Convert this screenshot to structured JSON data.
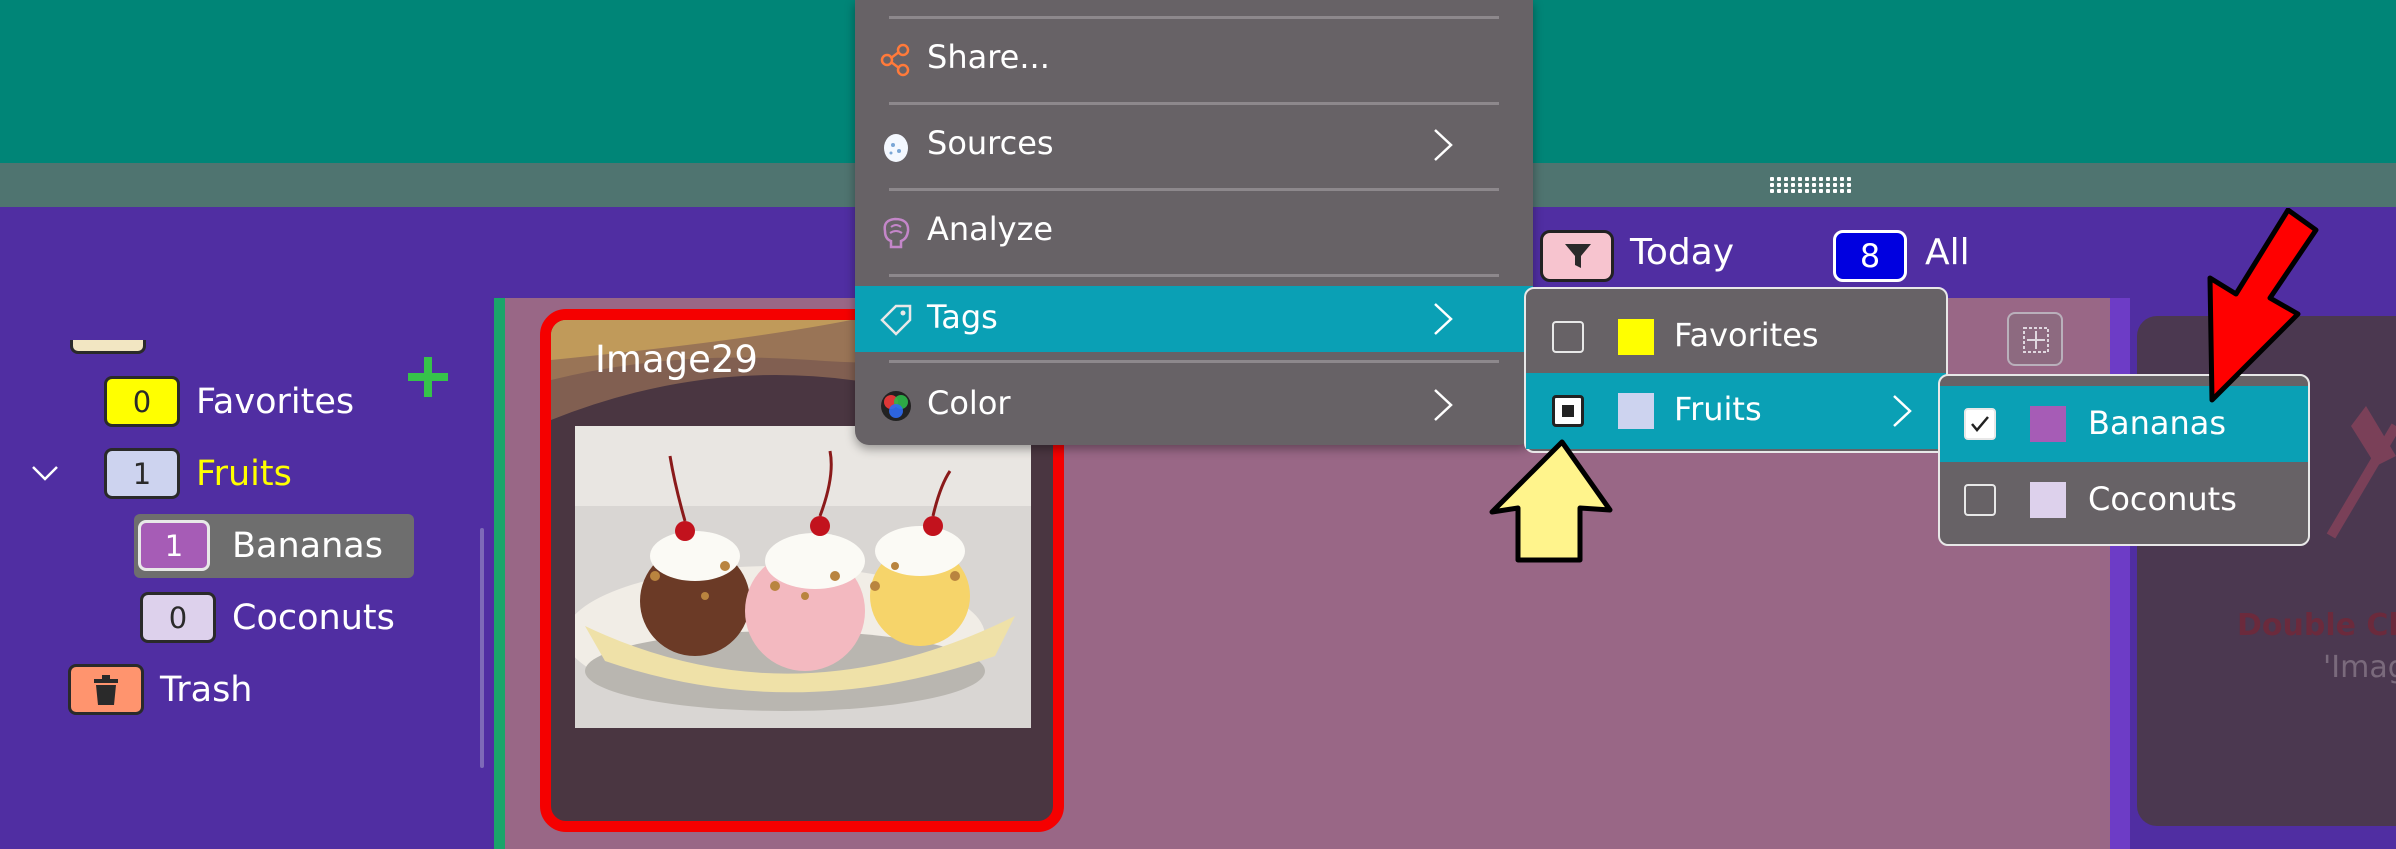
{
  "sidebar": {
    "tags": [
      {
        "name": "Favorites",
        "count": "0",
        "color": "#ffff00"
      },
      {
        "name": "Fruits",
        "count": "1",
        "color": "#cdd3ef"
      },
      {
        "name": "Bananas",
        "count": "1",
        "color": "#a65cb6"
      },
      {
        "name": "Coconuts",
        "count": "0",
        "color": "#ddd1ec"
      }
    ],
    "trash_label": "Trash",
    "trash_color": "#ff946e"
  },
  "toolbar": {
    "today_label": "Today",
    "all_count": "8",
    "all_label": "All"
  },
  "card": {
    "title": "Image29",
    "image_icon": "banana-split-photo"
  },
  "context_menu": {
    "items": [
      {
        "label": "Share...",
        "icon": "share-icon"
      },
      {
        "label": "Sources",
        "icon": "egg-icon"
      },
      {
        "label": "Analyze",
        "icon": "brain-icon"
      },
      {
        "label": "Tags",
        "icon": "tag-icon"
      },
      {
        "label": "Color",
        "icon": "color-wheel-icon"
      }
    ]
  },
  "tags_submenu": {
    "items": [
      {
        "label": "Favorites",
        "checked": false
      },
      {
        "label": "Fruits",
        "checked": "partial"
      }
    ]
  },
  "fruits_submenu": {
    "items": [
      {
        "label": "Bananas",
        "checked": true
      },
      {
        "label": "Coconuts",
        "checked": false
      }
    ]
  },
  "detail": {
    "hint_line1": "Double Cli",
    "hint_line2": "'Imag"
  },
  "colors": {
    "accent": "#0aa0b5",
    "header": "#008577",
    "background": "#502ea2",
    "card_border": "#f50000"
  }
}
